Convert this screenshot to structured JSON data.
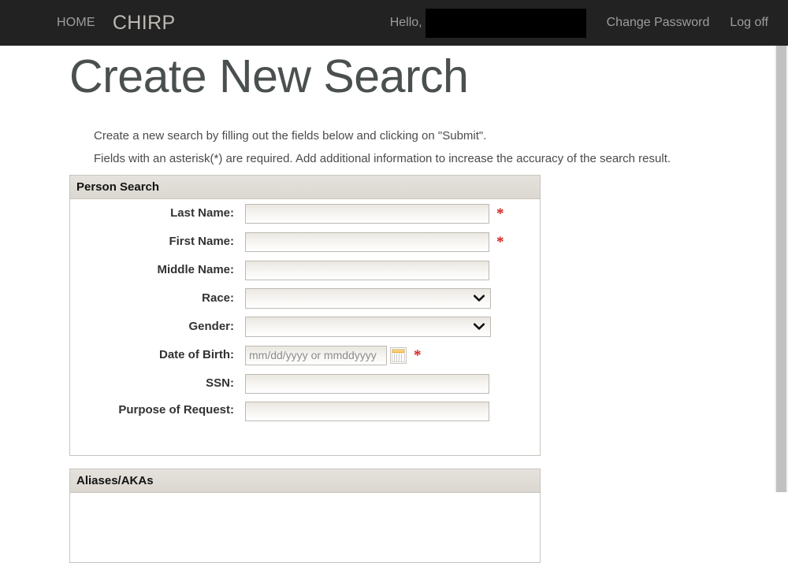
{
  "navbar": {
    "home_label": "HOME",
    "brand_label": "CHIRP",
    "hello_label": "Hello,",
    "username_redacted": "",
    "change_password_label": "Change Password",
    "logoff_label": "Log off"
  },
  "page": {
    "title": "Create New Search",
    "intro_line_1": "Create a new search by filling out the fields below and clicking on \"Submit\".",
    "intro_line_2": "Fields with an asterisk(*) are required. Add additional information to increase the accuracy of the search result."
  },
  "person_search_panel": {
    "title": "Person Search",
    "fields": [
      {
        "label": "Last Name:",
        "type": "text",
        "value": "",
        "placeholder": "",
        "required": true,
        "star": "*"
      },
      {
        "label": "First Name:",
        "type": "text",
        "value": "",
        "placeholder": "",
        "required": true,
        "star": "*"
      },
      {
        "label": "Middle Name:",
        "type": "text",
        "value": "",
        "placeholder": "",
        "required": false,
        "star": ""
      },
      {
        "label": "Race:",
        "type": "select",
        "value": "",
        "placeholder": "",
        "required": false,
        "star": ""
      },
      {
        "label": "Gender:",
        "type": "select",
        "value": "",
        "placeholder": "",
        "required": false,
        "star": ""
      },
      {
        "label": "Date of Birth:",
        "type": "date",
        "value": "",
        "placeholder": "mm/dd/yyyy or mmddyyyy",
        "required": true,
        "star": "*"
      },
      {
        "label": "SSN:",
        "type": "text",
        "value": "",
        "placeholder": "",
        "required": false,
        "star": ""
      },
      {
        "label": "Purpose of Request:",
        "type": "text",
        "value": "",
        "placeholder": "",
        "required": false,
        "star": ""
      }
    ]
  },
  "aliases_panel": {
    "title": "Aliases/AKAs"
  },
  "colors": {
    "navbar_bg": "#222222",
    "navbar_text": "#9d9d9d",
    "brand_text": "#bdb9b2",
    "title_text": "#4a4f4f",
    "panel_header_bg": "#dedad4",
    "panel_border": "#c8c5bf",
    "required_star": "#d42020",
    "calendar_icon_accent": "#f0a818",
    "scrollbar_thumb": "#c1c1c1"
  },
  "icons": {
    "chevron_down": "chevron-down-icon",
    "calendar": "calendar-icon"
  }
}
